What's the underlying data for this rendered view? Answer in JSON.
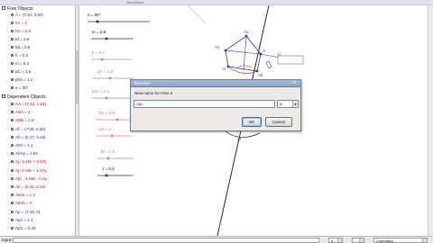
{
  "window": {
    "title": "GeoGebra"
  },
  "algebra": {
    "free_header": "Free Objects",
    "dependent_header": "Dependent Objects",
    "free_items": [
      {
        "text": "A = (7.34, 3.50)",
        "color": "blue"
      },
      {
        "text": "bA = 2",
        "color": "red"
      },
      {
        "text": "bC = 2.6",
        "color": "red"
      },
      {
        "text": "bf = 1.6",
        "color": "black"
      },
      {
        "text": "bd = 0.8",
        "color": "black"
      },
      {
        "text": "h = 0.4",
        "color": "black"
      },
      {
        "text": "m = 0.4",
        "color": "black"
      },
      {
        "text": "pC = 1.6",
        "color": "black"
      },
      {
        "text": "phA = 1.1",
        "color": "black"
      },
      {
        "text": "α = 30°",
        "color": "black"
      }
    ],
    "dependent_items": [
      {
        "text": "AA = (7.43, 1.64)",
        "color": "red"
      },
      {
        "text": "ABA = 2",
        "color": "red"
      },
      {
        "text": "ABB = 2.6",
        "color": "red"
      },
      {
        "text": "Af' = (7.08, 0.30)",
        "color": "blue"
      },
      {
        "text": "Ah = (6.17, 4.16)",
        "color": "blue"
      },
      {
        "text": "AhA = 1.1",
        "color": "blue"
      },
      {
        "text": "AhAp = 1.54",
        "color": "blue"
      },
      {
        "text": "Aj': 0.39x + 0.97y",
        "color": "red"
      },
      {
        "text": "Aj': 0.39x + 1.07y",
        "color": "red"
      },
      {
        "text": "AjC: -1.08x - 0.2y",
        "color": "red"
      },
      {
        "text": "Ak = (6.26, 2.16)",
        "color": "red"
      },
      {
        "text": "AkAk = 1.1",
        "color": "red"
      },
      {
        "text": "AkAh = 2",
        "color": "red"
      },
      {
        "text": "Ap = (7.48, 0)",
        "color": "blue"
      },
      {
        "text": "ApA = 1.1",
        "color": "blue"
      },
      {
        "text": "ApC = 0.45",
        "color": "blue"
      }
    ]
  },
  "canvas": {
    "sliders": [
      {
        "label": "α = 30°",
        "color": "#222"
      },
      {
        "label": "m = 2.8",
        "color": "#222"
      },
      {
        "label": "h = 0.4",
        "color": "#888"
      },
      {
        "label": "pC = 1.6",
        "color": "#888"
      },
      {
        "label": "phA = 1.1",
        "color": "#888"
      },
      {
        "label": "bC = 2.6",
        "color": "#d86060"
      },
      {
        "label": "bA = 2",
        "color": "#d86060"
      },
      {
        "label": "bf = 1.5",
        "color": "#888"
      },
      {
        "label": "t = 0.4",
        "color": "#222"
      }
    ],
    "point_labels": [
      "AC",
      "A",
      "C",
      "Ah",
      "Al",
      "Ak",
      "B",
      "Af"
    ]
  },
  "dialog": {
    "title": "Rename",
    "prompt": "New name for Ktee a",
    "input_value": "Aja",
    "combo_value": "α",
    "ok_label": "OK",
    "cancel_label": "Cancel"
  },
  "input_bar": {
    "label": "Input:",
    "combo_value": "α",
    "commands_value": "Command..."
  }
}
